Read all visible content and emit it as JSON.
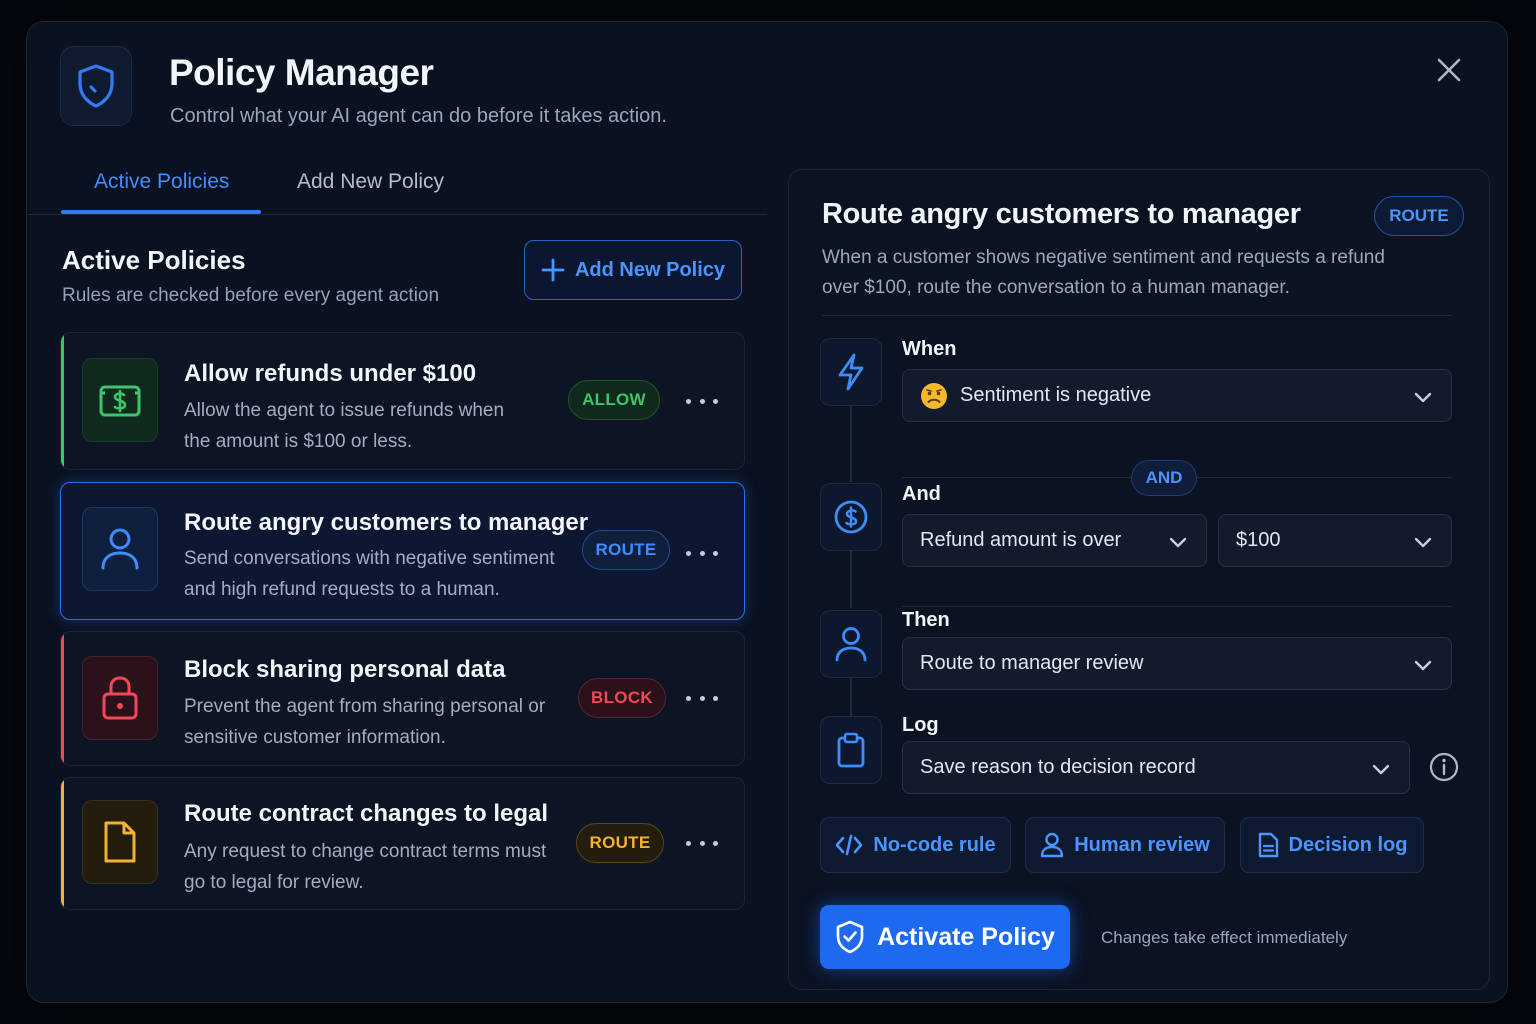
{
  "header": {
    "title": "Policy Manager",
    "subtitle": "Control what your AI agent can do before it takes action.",
    "icon": "shield-icon"
  },
  "tabs": [
    {
      "label": "Active Policies",
      "active": true
    },
    {
      "label": "Add New Policy",
      "active": false
    }
  ],
  "list": {
    "title": "Active Policies",
    "subtitle": "Rules are checked before every agent action",
    "add_button": "Add New Policy"
  },
  "policies": [
    {
      "title": "Allow refunds under $100",
      "desc": "Allow the agent to issue refunds when the amount is $100 or less.",
      "badge": "ALLOW",
      "icon": "dollar-bill-icon",
      "color": "#3ec46d"
    },
    {
      "title": "Route angry customers to manager",
      "desc": "Send conversations with negative sentiment and high refund requests to a human.",
      "badge": "ROUTE",
      "icon": "user-icon",
      "color": "#3f8cff"
    },
    {
      "title": "Block sharing personal data",
      "desc": "Prevent the agent from sharing personal or sensitive customer information.",
      "badge": "BLOCK",
      "icon": "lock-icon",
      "color": "#f0475a"
    },
    {
      "title": "Route contract changes to legal",
      "desc": "Any request to change contract terms must go to legal for review.",
      "badge": "ROUTE",
      "icon": "document-icon",
      "color": "#f2b233"
    }
  ],
  "detail": {
    "title": "Route angry customers to manager",
    "badge": "ROUTE",
    "desc": "When a customer shows negative sentiment and requests a refund over $100, route the conversation to a human manager.",
    "when": {
      "label": "When",
      "value": "Sentiment is negative"
    },
    "and_pill": "AND",
    "and": {
      "label": "And",
      "condition": "Refund amount is over",
      "amount": "$100"
    },
    "then": {
      "label": "Then",
      "value": "Route to manager review"
    },
    "log": {
      "label": "Log",
      "value": "Save reason to decision record"
    },
    "features": [
      "No-code rule",
      "Human review",
      "Decision log"
    ],
    "activate_button": "Activate Policy",
    "activate_note": "Changes take effect immediately"
  },
  "colors": {
    "accent": "#2f7cf6",
    "allow": "#3ec46d",
    "route": "#3f8cff",
    "block": "#f0475a",
    "legal": "#f2b233",
    "background": "#0a1120"
  }
}
